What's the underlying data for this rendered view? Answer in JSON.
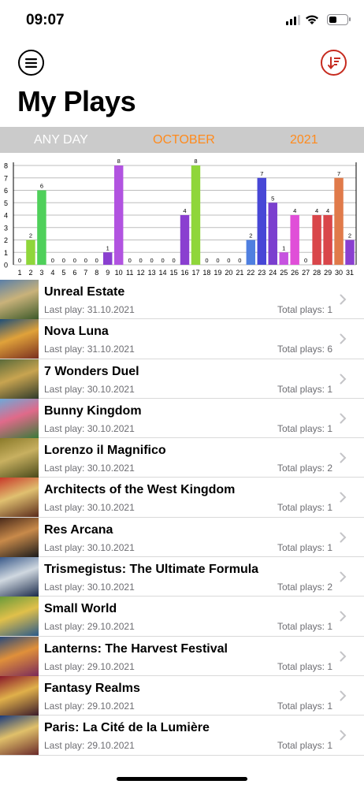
{
  "status": {
    "time": "09:07",
    "battery_level": 0.45
  },
  "header": {
    "title": "My Plays",
    "menu_icon": "hamburger-icon",
    "sort_icon": "sort-descending-icon"
  },
  "filter": {
    "any_day": "ANY DAY",
    "month": "OCTOBER",
    "year": "2021"
  },
  "chart_data": {
    "type": "bar",
    "categories": [
      "1",
      "2",
      "3",
      "4",
      "5",
      "6",
      "7",
      "8",
      "9",
      "10",
      "11",
      "12",
      "13",
      "14",
      "15",
      "16",
      "17",
      "18",
      "19",
      "20",
      "21",
      "22",
      "23",
      "24",
      "25",
      "26",
      "27",
      "28",
      "29",
      "30",
      "31"
    ],
    "values": [
      0,
      2,
      6,
      0,
      0,
      0,
      0,
      0,
      1,
      8,
      0,
      0,
      0,
      0,
      0,
      4,
      8,
      0,
      0,
      0,
      0,
      2,
      7,
      5,
      1,
      4,
      0,
      4,
      4,
      7,
      2
    ],
    "colors": [
      "#6cd06c",
      "#8fd63a",
      "#4fd05a",
      "#4fd05a",
      "#4fd05a",
      "#4fd05a",
      "#4fd05a",
      "#4fd05a",
      "#8a3fd0",
      "#b153e0",
      "#b153e0",
      "#b153e0",
      "#b153e0",
      "#b153e0",
      "#b153e0",
      "#8a3fd0",
      "#8fd63a",
      "#8fd63a",
      "#8fd63a",
      "#8fd63a",
      "#8fd63a",
      "#4f7fe0",
      "#4747d6",
      "#7b3fcf",
      "#c653e0",
      "#e04fd8",
      "#e04fd8",
      "#d9464a",
      "#d9464a",
      "#e07a4a",
      "#8a3fd0"
    ],
    "yticks": [
      "0",
      "1",
      "2",
      "3",
      "4",
      "5",
      "6",
      "7",
      "8"
    ],
    "ylim": [
      0,
      8
    ],
    "grid": true
  },
  "games": [
    {
      "name": "Unreal Estate",
      "last": "Last play: 31.10.2021",
      "total": "Total plays: 1",
      "thumb": [
        "#5a7fa8",
        "#c9b27a",
        "#3d5a2a"
      ]
    },
    {
      "name": "Nova Luna",
      "last": "Last play: 31.10.2021",
      "total": "Total plays: 6",
      "thumb": [
        "#1f4f78",
        "#e0a23a",
        "#7a2f1f"
      ]
    },
    {
      "name": "7 Wonders Duel",
      "last": "Last play: 30.10.2021",
      "total": "Total plays: 1",
      "thumb": [
        "#5a6a3a",
        "#c8a450",
        "#2f3a2a"
      ]
    },
    {
      "name": "Bunny Kingdom",
      "last": "Last play: 30.10.2021",
      "total": "Total plays: 1",
      "thumb": [
        "#6fa8d8",
        "#e06a8a",
        "#3a7a3a"
      ]
    },
    {
      "name": "Lorenzo il Magnifico",
      "last": "Last play: 30.10.2021",
      "total": "Total plays: 2",
      "thumb": [
        "#8a7a2a",
        "#c8b060",
        "#4a4a1a"
      ]
    },
    {
      "name": "Architects of the West Kingdom",
      "last": "Last play: 30.10.2021",
      "total": "Total plays: 1",
      "thumb": [
        "#c83a2a",
        "#e0c070",
        "#5a2a1a"
      ]
    },
    {
      "name": "Res Arcana",
      "last": "Last play: 30.10.2021",
      "total": "Total plays: 1",
      "thumb": [
        "#4a2a1a",
        "#c88a4a",
        "#1a1a1a"
      ]
    },
    {
      "name": "Trismegistus: The Ultimate Formula",
      "last": "Last play: 30.10.2021",
      "total": "Total plays: 2",
      "thumb": [
        "#3a5a8a",
        "#d0d8e0",
        "#1a2a4a"
      ]
    },
    {
      "name": "Small World",
      "last": "Last play: 29.10.2021",
      "total": "Total plays: 1",
      "thumb": [
        "#6a9a3a",
        "#e0c04a",
        "#2a5a8a"
      ]
    },
    {
      "name": "Lanterns: The Harvest Festival",
      "last": "Last play: 29.10.2021",
      "total": "Total plays: 1",
      "thumb": [
        "#2a4a7a",
        "#e0903a",
        "#7a2a5a"
      ]
    },
    {
      "name": "Fantasy Realms",
      "last": "Last play: 29.10.2021",
      "total": "Total plays: 1",
      "thumb": [
        "#8a1a2a",
        "#e0b04a",
        "#3a1a2a"
      ]
    },
    {
      "name": "Paris: La Cité de la Lumière",
      "last": "Last play: 29.10.2021",
      "total": "Total plays: 1",
      "thumb": [
        "#1a3a7a",
        "#e0c06a",
        "#6a2a2a"
      ]
    }
  ]
}
